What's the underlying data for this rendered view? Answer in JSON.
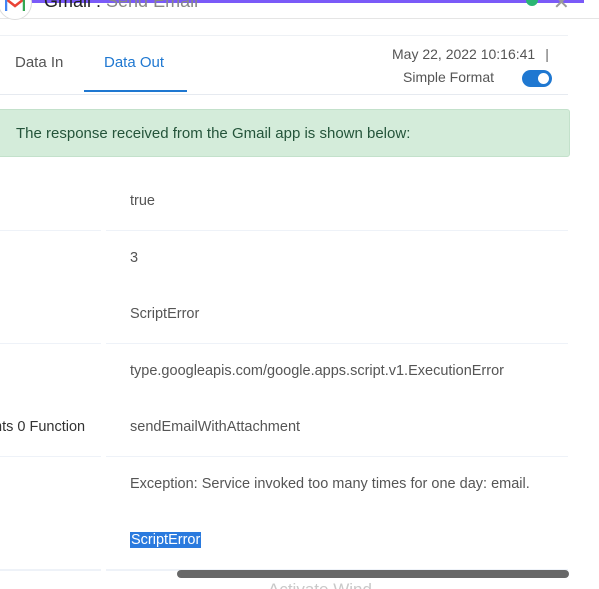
{
  "header": {
    "app_name": "Gmail",
    "separator": " : ",
    "action": "Send Email"
  },
  "tabs": [
    {
      "label": "Data In",
      "active": false
    },
    {
      "label": "Data Out",
      "active": true
    }
  ],
  "meta": {
    "timestamp": "May 22, 2022 10:16:41",
    "pipe": "|",
    "format_label": "Simple Format",
    "simple_format_on": true
  },
  "banner": {
    "text": "The response received from the Gmail app is shown below:"
  },
  "rows": [
    {
      "key": "",
      "value": "true"
    },
    {
      "key": "",
      "value": "3"
    },
    {
      "key": "",
      "value": "ScriptError"
    },
    {
      "key": "",
      "value": "type.googleapis.com/google.apps.script.v1.ExecutionError"
    },
    {
      "key": "nts 0 Function",
      "value": "sendEmailWithAttachment"
    },
    {
      "key": "",
      "value": "Exception: Service invoked too many times for one day: email."
    },
    {
      "key": "",
      "value": "ScriptError",
      "selected": true
    }
  ],
  "watermark": "Activate Wind",
  "colors": {
    "accent": "#1f78d1",
    "banner_bg": "#d4ecda",
    "banner_text": "#24543a",
    "header_line": "#7a5af8",
    "status_ok": "#2bb673",
    "selection": "#2a7ade"
  }
}
